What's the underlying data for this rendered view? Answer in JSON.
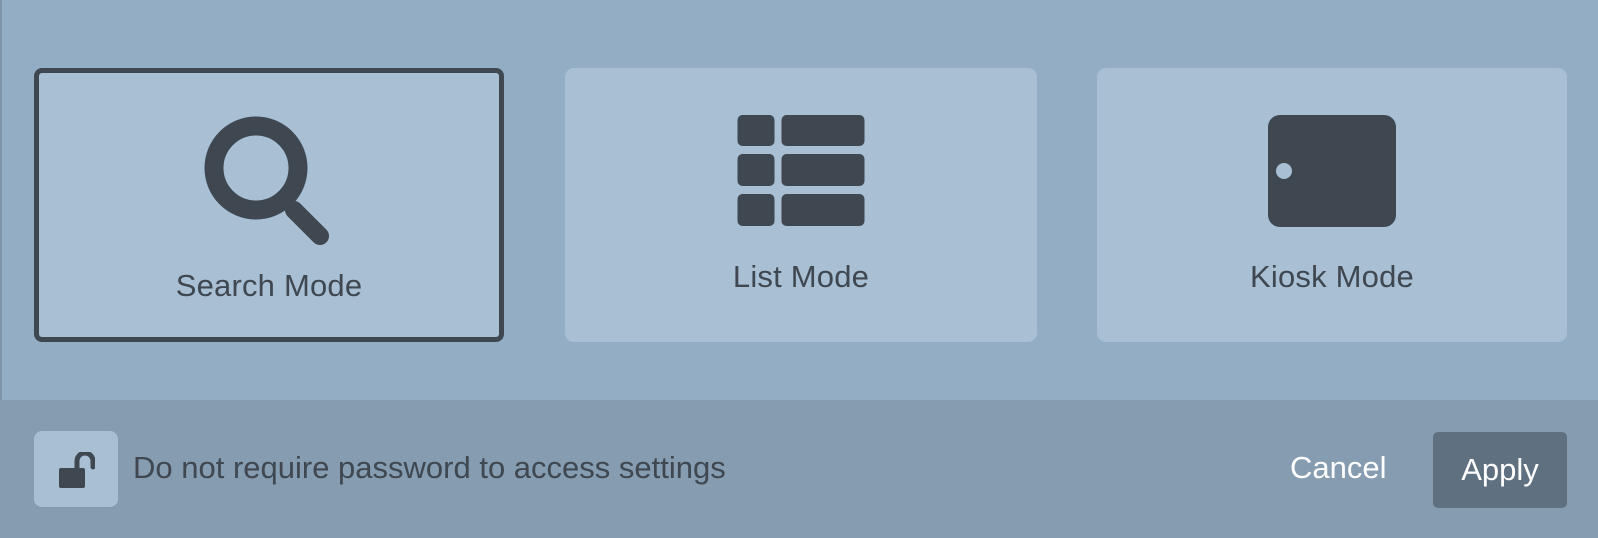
{
  "modes": [
    {
      "label": "Search Mode",
      "icon": "search-icon",
      "selected": true
    },
    {
      "label": "List Mode",
      "icon": "list-icon",
      "selected": false
    },
    {
      "label": "Kiosk Mode",
      "icon": "kiosk-icon",
      "selected": false
    }
  ],
  "footer": {
    "lock_icon": "unlock-icon",
    "password_label": "Do not require password to access settings",
    "cancel_label": "Cancel",
    "apply_label": "Apply"
  },
  "colors": {
    "background": "#93aec4",
    "card": "#a8bfd4",
    "footer": "#869cb0",
    "icon": "#3f4750",
    "apply_button": "#5f7081",
    "text_light": "#ffffff"
  }
}
